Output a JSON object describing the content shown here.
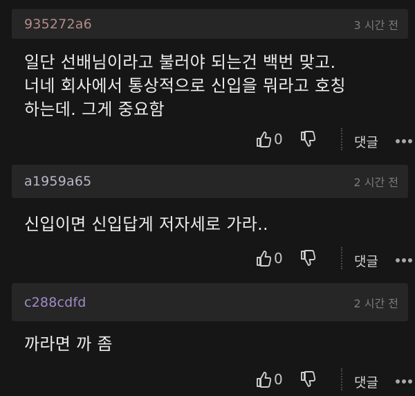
{
  "comments": [
    {
      "author": "935272a6",
      "author_color": "#b58a8a",
      "time": "3 시간 전",
      "lines": [
        "일단 선배님이라고 불러야 되는건 백번 맞고.",
        "너네 회사에서 통상적으로 신입을 뭐라고 호칭",
        "하는데. 그게 중요함"
      ],
      "likes": "0",
      "reply_label": "댓글"
    },
    {
      "author": "a1959a65",
      "author_color": "#b8b8c8",
      "time": "2 시간 전",
      "lines": [
        "신입이면 신입답게 저자세로 가라.."
      ],
      "likes": "0",
      "reply_label": "댓글"
    },
    {
      "author": "c288cdfd",
      "author_color": "#a48ac8",
      "time": "2 시간 전",
      "lines": [
        "까라면 까 좀"
      ],
      "likes": "0",
      "reply_label": "댓글"
    }
  ],
  "icons": {
    "like": "thumbs-up-icon",
    "dislike": "thumbs-down-icon",
    "more": "more-horizontal-icon"
  }
}
